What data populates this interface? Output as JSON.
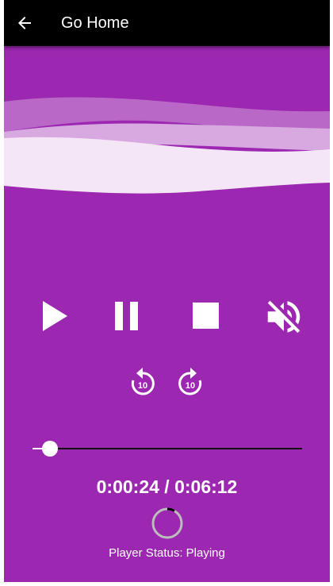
{
  "app_bar": {
    "title": "Go Home",
    "back_icon": "arrow-back-icon"
  },
  "colors": {
    "background": "#9c27b0",
    "app_bar": "#000000",
    "foreground": "#ffffff"
  },
  "controls": {
    "play_icon": "play-icon",
    "pause_icon": "pause-icon",
    "stop_icon": "stop-icon",
    "mute_icon": "volume-off-icon",
    "replay10_icon": "replay-10-icon",
    "forward10_icon": "forward-10-icon",
    "skip_seconds": "10"
  },
  "progress": {
    "position": "0:00:24",
    "duration": "0:06:12",
    "display": "0:00:24 / 0:06:12",
    "fraction": 0.0645
  },
  "status": {
    "text": "Player Status: Playing"
  }
}
